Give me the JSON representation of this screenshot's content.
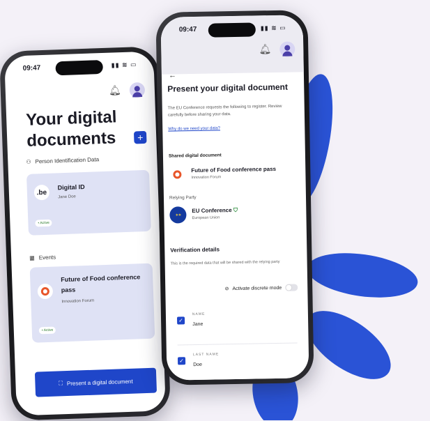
{
  "colors": {
    "accent": "#1f46c9",
    "background": "#f4f1f8",
    "card": "#dfe2f5",
    "flower": "#2a53d6"
  },
  "left_phone": {
    "time": "09:47",
    "title": "Your digital documents",
    "sections": {
      "pid_label": "Person Identification Data",
      "events_label": "Events"
    },
    "cards": [
      {
        "logo": ".be",
        "title": "Digital ID",
        "subtitle": "Jane Doe",
        "badge": "• Active"
      },
      {
        "title": "Future of Food conference pass",
        "subtitle": "Innovation Forum",
        "badge": "• Active"
      }
    ],
    "present_button": "Present a digital document"
  },
  "right_phone": {
    "time": "09:47",
    "title": "Present your digital document",
    "description": "The EU Conference requests the following to register. Review carefully before sharing your data.",
    "link": "Why do we need your data?",
    "shared_label": "Shared digital document",
    "shared_doc": {
      "title": "Future of Food conference pass",
      "subtitle": "Innovation Forum"
    },
    "relying_label": "Relying Party",
    "relying": {
      "title": "EU Conference",
      "subtitle": "European Union"
    },
    "verification_title": "Verification details",
    "verification_desc": "This is the required data that will be shared with the relying party",
    "discrete_mode": "Activate discrete mode",
    "fields": [
      {
        "label": "NAME",
        "value": "Jane"
      },
      {
        "label": "LAST NAME",
        "value": "Doe"
      }
    ]
  }
}
